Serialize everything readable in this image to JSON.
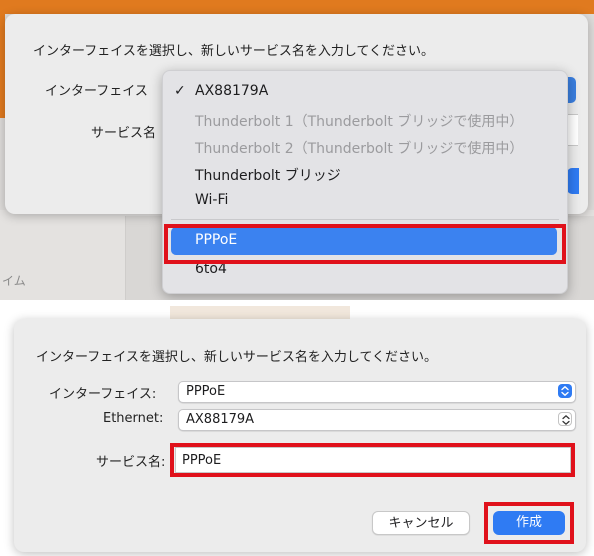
{
  "top_dialog": {
    "prompt": "インターフェイスを選択し、新しいサービス名を入力してください。",
    "interface_label": "インターフェイス",
    "service_name_label": "サービス名",
    "background_fragment": "イム",
    "menu": {
      "items": [
        {
          "label": "AX88179A",
          "checked": true,
          "enabled": true
        },
        {
          "label": "Thunderbolt 1（Thunderbolt ブリッジで使用中）",
          "enabled": false
        },
        {
          "label": "Thunderbolt 2（Thunderbolt ブリッジで使用中）",
          "enabled": false
        },
        {
          "label": "Thunderbolt ブリッジ",
          "enabled": true
        },
        {
          "label": "Wi-Fi",
          "enabled": true
        },
        {
          "label": "PPPoE",
          "enabled": true,
          "highlighted": true
        },
        {
          "label": "6to4",
          "enabled": true
        }
      ],
      "check_mark": "✓"
    }
  },
  "bottom_dialog": {
    "prompt": "インターフェイスを選択し、新しいサービス名を入力してください。",
    "interface_label": "インターフェイス:",
    "interface_value": "PPPoE",
    "ethernet_label": "Ethernet:",
    "ethernet_value": "AX88179A",
    "service_name_label": "サービス名:",
    "service_name_value": "PPPoE",
    "cancel_label": "キャンセル",
    "create_label": "作成"
  },
  "colors": {
    "accent": "#2f7bf3",
    "highlight_box": "#e0111b",
    "frame_orange": "#e07a1f"
  },
  "icons": {
    "stepper": "chevron-up-down-icon",
    "check": "checkmark-icon"
  }
}
